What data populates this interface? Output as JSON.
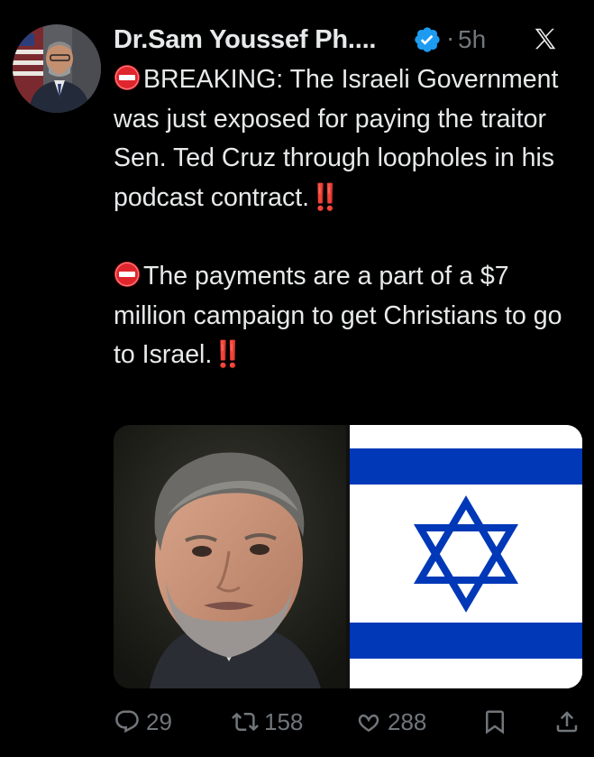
{
  "tweet": {
    "author_name": "Dr.Sam Youssef Ph....",
    "separator": "·",
    "time": "5h",
    "paragraph1": "BREAKING: The Israeli Government was just exposed for paying the traitor Sen. Ted Cruz through loopholes in his podcast contract.",
    "paragraph2": "The payments are a part of a $7 million campaign to get Christians to go to Israel.",
    "emphasis": "‼️"
  },
  "media": {
    "left_image": "portrait-photo",
    "right_image": "israel-flag"
  },
  "actions": {
    "replies": "29",
    "reposts": "158",
    "likes": "288"
  },
  "colors": {
    "background": "#000000",
    "text": "#e7e9ea",
    "muted": "#71767b",
    "verified": "#1d9bf0",
    "alert_red": "#e0262d",
    "flag_blue": "#0038b8"
  }
}
